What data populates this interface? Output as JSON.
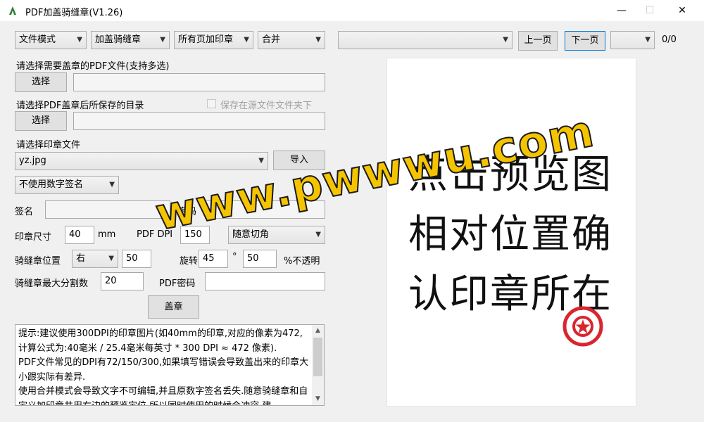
{
  "window": {
    "title": "PDF加盖骑缝章(V1.26)",
    "minimize": "—",
    "maximize": "☐",
    "close": "✕"
  },
  "toolbar": {
    "mode_combo": "文件模式",
    "stamp_type_combo": "加盖骑缝章",
    "pages_combo": "所有页加印章",
    "merge_combo": "合并",
    "preview_file_combo": "",
    "prev_page": "上一页",
    "next_page": "下一页",
    "page_combo": "",
    "page_count": "0/0"
  },
  "pdf_select": {
    "label": "请选择需要盖章的PDF文件(支持多选)",
    "button": "选择",
    "value": ""
  },
  "save_dir": {
    "label": "请选择PDF盖章后所保存的目录",
    "checkbox_label": "保存在源文件文件夹下",
    "button": "选择",
    "value": ""
  },
  "stamp_file": {
    "label": "请选择印章文件",
    "value": "yz.jpg",
    "import_button": "导入"
  },
  "signature": {
    "combo": "不使用数字签名",
    "sign_label": "签名",
    "sign_value": "",
    "password_label": "密码",
    "password_value": ""
  },
  "stamp_size": {
    "label": "印章尺寸",
    "value": "40",
    "unit": "mm",
    "dpi_label": "PDF DPI",
    "dpi_value": "150",
    "extra_combo": "随意切角"
  },
  "seam_position": {
    "label": "骑缝章位置",
    "side_combo": "右",
    "offset_value": "50",
    "rotate_label": "旋转",
    "rotate_value": "45",
    "degree": "°",
    "opacity_value": "50",
    "opacity_label": "%不透明"
  },
  "seam_split": {
    "label": "骑缝章最大分割数",
    "value": "20",
    "pdf_password_label": "PDF密码",
    "pdf_password_value": ""
  },
  "stamp_button": "盖章",
  "hint_text": "提示:建议使用300DPI的印章图片(如40mm的印章,对应的像素为472,计算公式为:40毫米 / 25.4毫米每英寸 * 300 DPI ≈ 472 像素).\nPDF文件常见的DPI有72/150/300,如果填写错误会导致盖出来的印章大小跟实际有差异.\n使用合并模式会导致文字不可编辑,并且原数字签名丢失.随意骑缝章和自定义加印章共用右边的预览定位,所以同时使用的时候会冲突,建",
  "preview": {
    "line1": "点击预览图",
    "line2": "相对位置确",
    "line3": "认印章所在"
  },
  "watermark": "www.pwwwu.com",
  "colors": {
    "stamp_red": "#d9262e",
    "watermark_yellow": "#f5c400",
    "window_bg": "#f0f0f0"
  }
}
